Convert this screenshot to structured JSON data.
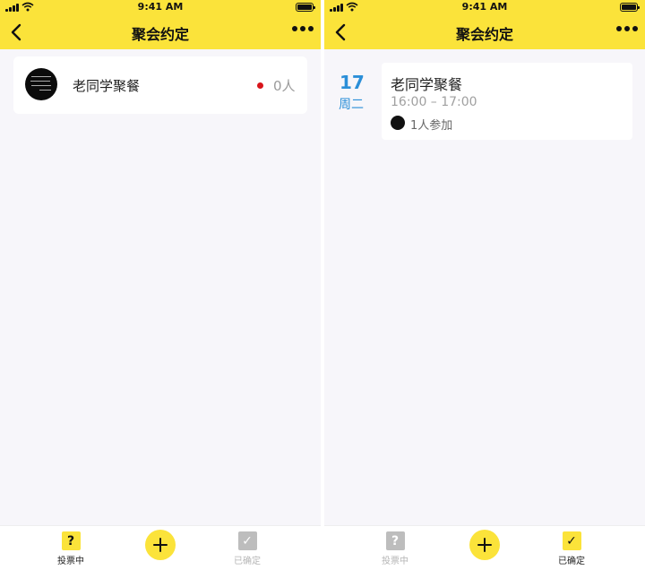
{
  "status": {
    "time": "9:41 AM"
  },
  "nav": {
    "title": "聚会约定"
  },
  "left_screen": {
    "event": {
      "title": "老同学聚餐",
      "count": "0人"
    },
    "tabs": [
      {
        "label": "投票中",
        "glyph": "?",
        "active": true
      },
      {
        "label": "已确定",
        "glyph": "✓",
        "active": false
      }
    ]
  },
  "right_screen": {
    "date": {
      "day": "17",
      "weekday": "周二"
    },
    "event": {
      "title": "老同学聚餐",
      "time": "16:00 – 17:00",
      "joined": "1人参加"
    },
    "tabs": [
      {
        "label": "投票中",
        "glyph": "?",
        "active": false
      },
      {
        "label": "已确定",
        "glyph": "✓",
        "active": true
      }
    ]
  },
  "colors": {
    "accent": "#fbe33a",
    "date_blue": "#2b8fd8",
    "dot_red": "#d8151b"
  }
}
